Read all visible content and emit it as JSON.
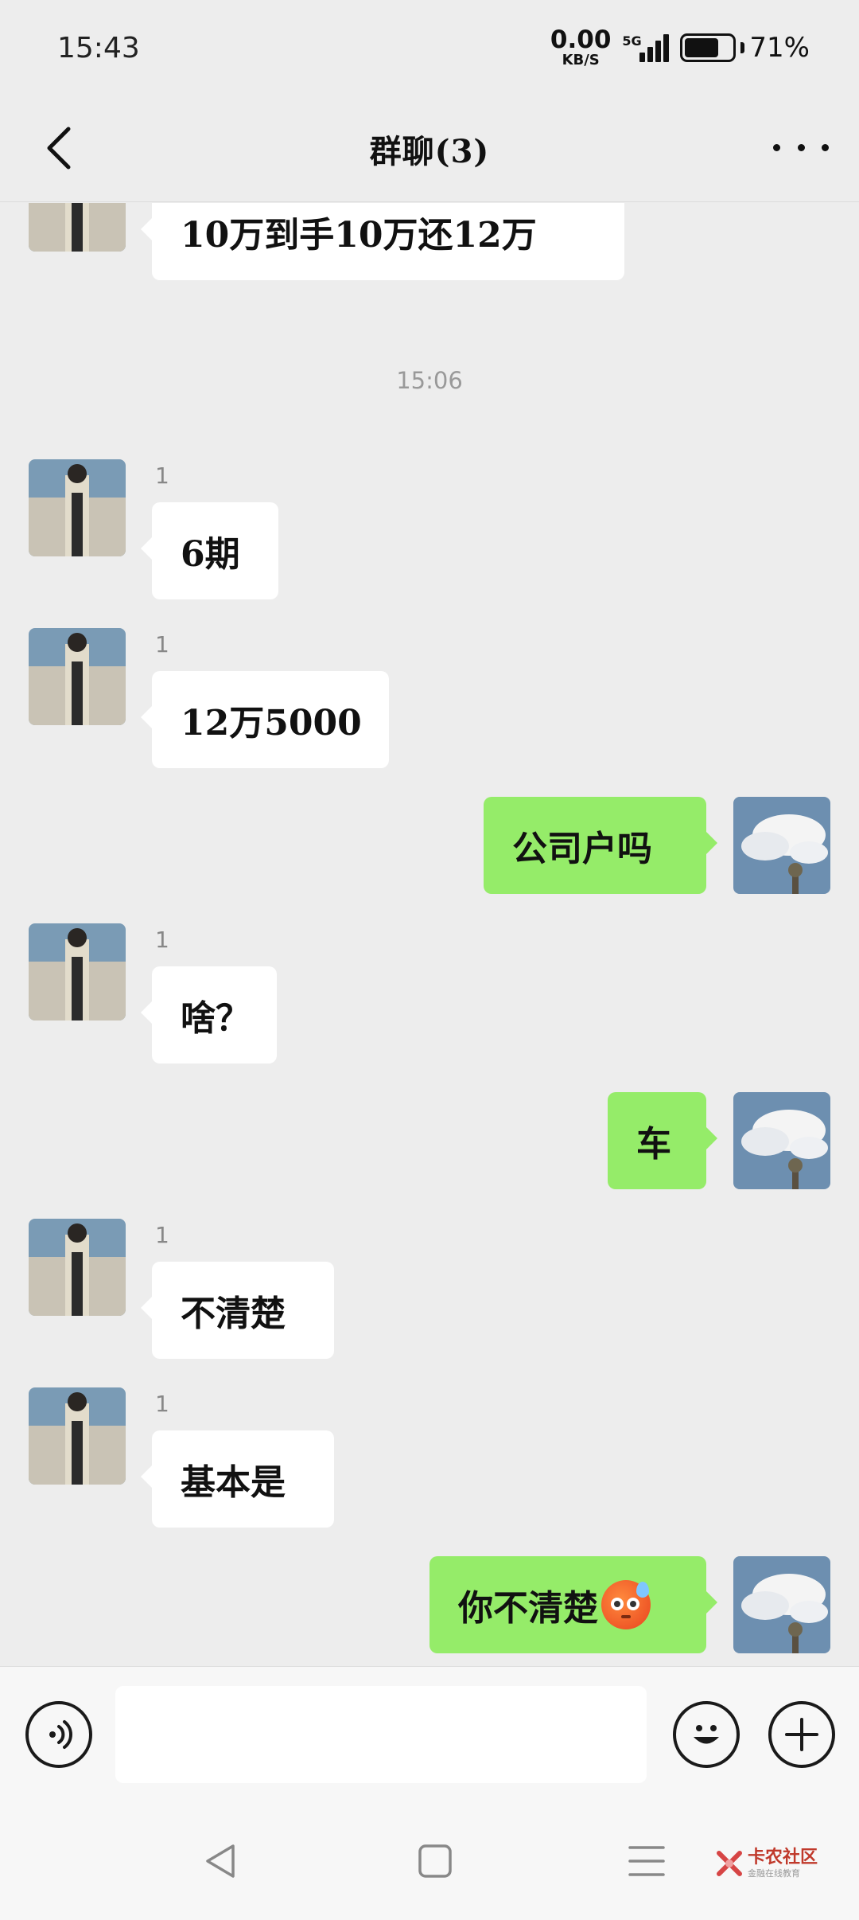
{
  "status_bar": {
    "time": "15:43",
    "net_speed_value": "0.00",
    "net_speed_unit": "KB/S",
    "network_type": "5G",
    "battery_percent": "71%",
    "battery_level": 0.71
  },
  "header": {
    "title": "群聊(3)"
  },
  "messages": [
    {
      "direction": "in",
      "sender": "",
      "text": "10万到手10万还12万"
    },
    {
      "type": "timestamp",
      "text": "15:06"
    },
    {
      "direction": "in",
      "sender": "1",
      "text": "6期"
    },
    {
      "direction": "in",
      "sender": "1",
      "text": "12万5000"
    },
    {
      "direction": "out",
      "text": "公司户吗"
    },
    {
      "direction": "in",
      "sender": "1",
      "text": "啥？"
    },
    {
      "direction": "out",
      "text": "车"
    },
    {
      "direction": "in",
      "sender": "1",
      "text": "不清楚"
    },
    {
      "direction": "in",
      "sender": "1",
      "text": "基本是"
    },
    {
      "direction": "out",
      "text": "你不清楚",
      "emoji": "sweat-emoji"
    }
  ],
  "input_bar": {
    "placeholder": "",
    "value": ""
  },
  "watermark": {
    "main": "卡农社区",
    "sub": "金融在线教育"
  },
  "colors": {
    "background": "#ededed",
    "outgoing_bubble": "#95ec69",
    "incoming_bubble": "#ffffff"
  },
  "icons": {
    "back": "chevron-left-icon",
    "more": "more-dots-icon",
    "voice": "voice-icon",
    "emoji": "smiley-icon",
    "plus": "plus-icon"
  }
}
